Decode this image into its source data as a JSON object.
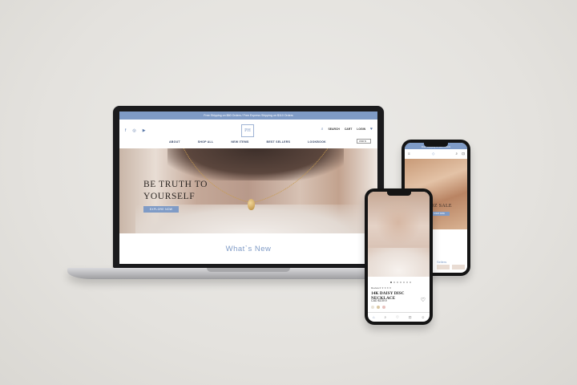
{
  "laptop": {
    "announcement": "Free Shipping on $60 Orders / Free Express Shipping on $110 Orders",
    "social": {
      "facebook": "f",
      "instagram": "◎",
      "youtube": "▶"
    },
    "logo": "PH",
    "utility": {
      "search": "SEARCH",
      "cart": "CART",
      "login": "LOGIN"
    },
    "nav": [
      "ABOUT",
      "SHOP ALL",
      "NEW ITEMS",
      "BEST SELLERS",
      "LOOKBOOK"
    ],
    "currency": "USD $",
    "hero": {
      "title_line1": "BE TRUTH TO",
      "title_line2": "YOURSELF",
      "cta": "EXPLORE NOW"
    },
    "section_title": "What`s New"
  },
  "phone_back": {
    "announcement": "Free Shipping on $60 Orders",
    "sale_text": "ROZ SALE",
    "cta": "SHOP NOW",
    "section": "Sellers"
  },
  "phone_front": {
    "review_label": "Review",
    "stars": "★★★★★",
    "product_name": "14K DAISY DISC NECKLACE",
    "price": "CAD $139.9",
    "swatch_colors": [
      "#e9e3d7",
      "#d9c7a1",
      "#e7c1bd"
    ]
  },
  "colors": {
    "accent": "#7f9bc6",
    "nav_text": "#3a4a6a"
  },
  "icons": [
    "search-icon",
    "heart-icon",
    "home-icon",
    "menu-icon",
    "cart-icon",
    "user-icon"
  ]
}
